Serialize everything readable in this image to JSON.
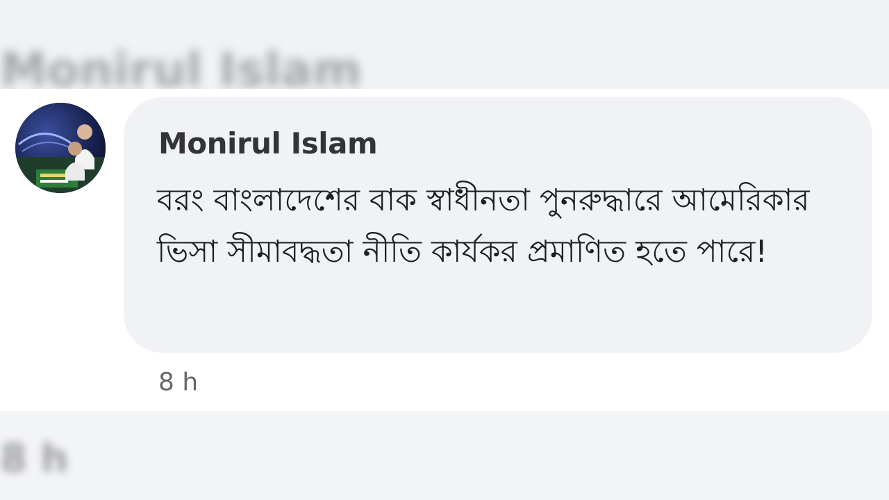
{
  "background_header": {
    "name_text": "Monirul Islam"
  },
  "comment": {
    "author": "Monirul Islam",
    "text": "বরং বাংলাদেশের বাক স্বাধীনতা পুনরুদ্ধারে আমেরিকার ভিসা সীমাবদ্ধতা নীতি কার্যকর প্রমাণিত হতে পারে!",
    "timestamp": "8 h"
  },
  "background_footer": {
    "time_text": "8 h"
  },
  "colors": {
    "bubble": "#f0f2f5",
    "page": "#ffffff",
    "author": "#333437",
    "meta": "#65676b"
  }
}
